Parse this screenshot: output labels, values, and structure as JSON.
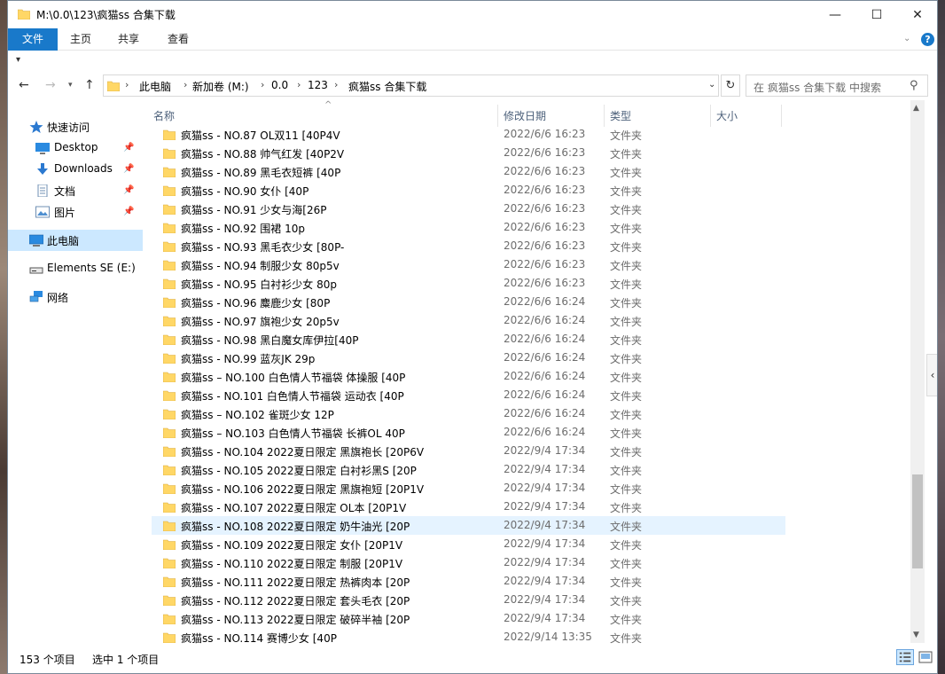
{
  "window": {
    "title": "M:\\0.0\\123\\疯猫ss 合集下载",
    "min_glyph": "—",
    "max_glyph": "☐",
    "close_glyph": "✕"
  },
  "ribbon": {
    "tabs": [
      "文件",
      "主页",
      "共享",
      "查看"
    ],
    "help": "?"
  },
  "address": {
    "crumbs": [
      "此电脑",
      "新加卷 (M:)",
      "0.0",
      "123",
      "疯猫ss 合集下载"
    ],
    "search_placeholder": "在 疯猫ss 合集下载 中搜索"
  },
  "nav_pane": {
    "items": [
      {
        "label": "快速访问",
        "icon": "star-icon"
      },
      {
        "label": "Desktop",
        "icon": "desktop-icon",
        "pinned": true
      },
      {
        "label": "Downloads",
        "icon": "download-icon",
        "pinned": true
      },
      {
        "label": "文档",
        "icon": "document-icon",
        "pinned": true
      },
      {
        "label": "图片",
        "icon": "picture-icon",
        "pinned": true
      },
      {
        "label": "此电脑",
        "icon": "computer-icon",
        "selected": true
      },
      {
        "label": "Elements SE (E:)",
        "icon": "drive-icon"
      },
      {
        "label": "网络",
        "icon": "network-icon"
      }
    ]
  },
  "columns": {
    "name": "名称",
    "date": "修改日期",
    "type": "类型",
    "size": "大小"
  },
  "files": [
    {
      "name": "疯猫ss - NO.87 OL双11 [40P4V",
      "date": "2022/6/6 16:23",
      "type": "文件夹"
    },
    {
      "name": "疯猫ss - NO.88 帅气红发 [40P2V",
      "date": "2022/6/6 16:23",
      "type": "文件夹"
    },
    {
      "name": "疯猫ss - NO.89 黑毛衣短裤 [40P",
      "date": "2022/6/6 16:23",
      "type": "文件夹"
    },
    {
      "name": "疯猫ss - NO.90 女仆 [40P",
      "date": "2022/6/6 16:23",
      "type": "文件夹"
    },
    {
      "name": "疯猫ss - NO.91 少女与海[26P",
      "date": "2022/6/6 16:23",
      "type": "文件夹"
    },
    {
      "name": "疯猫ss - NO.92 围裙 10p",
      "date": "2022/6/6 16:23",
      "type": "文件夹"
    },
    {
      "name": "疯猫ss - NO.93 黑毛衣少女 [80P-",
      "date": "2022/6/6 16:23",
      "type": "文件夹"
    },
    {
      "name": "疯猫ss - NO.94 制服少女 80p5v",
      "date": "2022/6/6 16:23",
      "type": "文件夹"
    },
    {
      "name": "疯猫ss - NO.95 白衬衫少女 80p",
      "date": "2022/6/6 16:23",
      "type": "文件夹"
    },
    {
      "name": "疯猫ss - NO.96 麋鹿少女 [80P",
      "date": "2022/6/6 16:24",
      "type": "文件夹"
    },
    {
      "name": "疯猫ss - NO.97 旗袍少女 20p5v",
      "date": "2022/6/6 16:24",
      "type": "文件夹"
    },
    {
      "name": "疯猫ss - NO.98 黑白魔女库伊拉[40P",
      "date": "2022/6/6 16:24",
      "type": "文件夹"
    },
    {
      "name": "疯猫ss - NO.99 蓝灰JK 29p",
      "date": "2022/6/6 16:24",
      "type": "文件夹"
    },
    {
      "name": "疯猫ss – NO.100 白色情人节福袋 体操服 [40P",
      "date": "2022/6/6 16:24",
      "type": "文件夹"
    },
    {
      "name": "疯猫ss - NO.101 白色情人节福袋 运动衣 [40P",
      "date": "2022/6/6 16:24",
      "type": "文件夹"
    },
    {
      "name": "疯猫ss – NO.102 雀斑少女 12P",
      "date": "2022/6/6 16:24",
      "type": "文件夹"
    },
    {
      "name": "疯猫ss – NO.103 白色情人节福袋 长裤OL  40P",
      "date": "2022/6/6 16:24",
      "type": "文件夹"
    },
    {
      "name": "疯猫ss - NO.104 2022夏日限定 黑旗袍长 [20P6V",
      "date": "2022/9/4 17:34",
      "type": "文件夹"
    },
    {
      "name": "疯猫ss - NO.105 2022夏日限定 白衬衫黑S [20P",
      "date": "2022/9/4 17:34",
      "type": "文件夹"
    },
    {
      "name": "疯猫ss - NO.106 2022夏日限定 黑旗袍短 [20P1V",
      "date": "2022/9/4 17:34",
      "type": "文件夹"
    },
    {
      "name": "疯猫ss - NO.107 2022夏日限定 OL本 [20P1V",
      "date": "2022/9/4 17:34",
      "type": "文件夹"
    },
    {
      "name": "疯猫ss - NO.108 2022夏日限定 奶牛油光 [20P",
      "date": "2022/9/4 17:34",
      "type": "文件夹",
      "selected": true
    },
    {
      "name": "疯猫ss - NO.109 2022夏日限定 女仆 [20P1V",
      "date": "2022/9/4 17:34",
      "type": "文件夹"
    },
    {
      "name": "疯猫ss - NO.110 2022夏日限定 制服 [20P1V",
      "date": "2022/9/4 17:34",
      "type": "文件夹"
    },
    {
      "name": "疯猫ss - NO.111 2022夏日限定 热裤肉本 [20P",
      "date": "2022/9/4 17:34",
      "type": "文件夹"
    },
    {
      "name": "疯猫ss - NO.112 2022夏日限定 套头毛衣 [20P",
      "date": "2022/9/4 17:34",
      "type": "文件夹"
    },
    {
      "name": "疯猫ss - NO.113 2022夏日限定 破碎半袖 [20P",
      "date": "2022/9/4 17:34",
      "type": "文件夹"
    },
    {
      "name": "疯猫ss - NO.114 赛博少女 [40P",
      "date": "2022/9/14 13:35",
      "type": "文件夹"
    }
  ],
  "scroll": {
    "position": 0.86
  },
  "status": {
    "count": "153 个项目",
    "selected": "选中 1 个项目"
  },
  "colors": {
    "accent": "#1979ca",
    "selection": "#cce8ff",
    "row_selection": "#e5f3ff",
    "folder": "#ffd766"
  }
}
